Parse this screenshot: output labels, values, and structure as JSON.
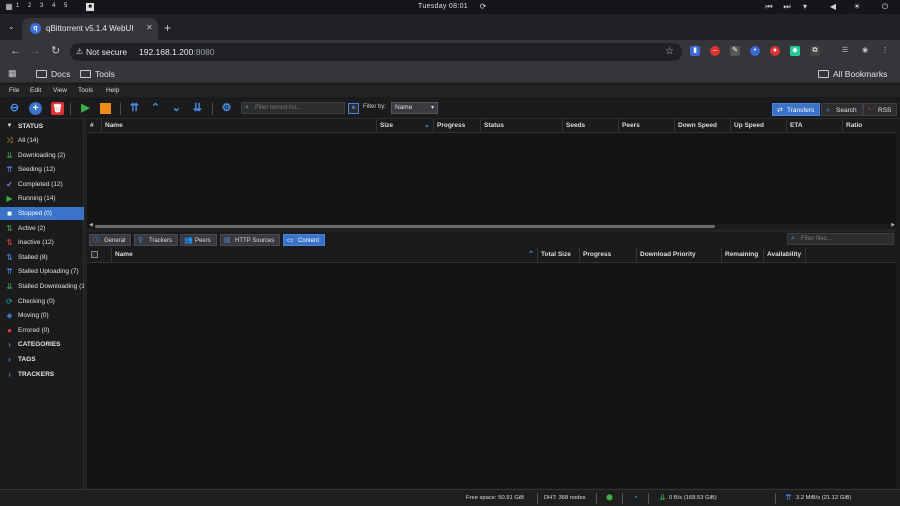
{
  "os": {
    "workspaces": [
      "1",
      "2",
      "3",
      "4",
      "5"
    ],
    "clock": "Tuesday 08:01"
  },
  "browser": {
    "tab_title": "qBittorrent v5.1.4 WebUI",
    "new_tab": "+",
    "address": {
      "security": "Not secure",
      "host": "192.168.1.200",
      "port": ":8080"
    },
    "bookmarks": [
      "Docs",
      "Tools"
    ],
    "all_bookmarks": "All Bookmarks"
  },
  "menu": [
    "File",
    "Edit",
    "View",
    "Tools",
    "Help"
  ],
  "toolbar": {
    "filter_placeholder": "Filter torrent list...",
    "filter_by_label": "Filter by:",
    "filter_by_value": "Name",
    "buttons": [
      "Transfers",
      "Search",
      "RSS"
    ]
  },
  "sidebar": {
    "status_header": "STATUS",
    "items": [
      {
        "label": "All (14)",
        "icon": "shuffle-icon",
        "color": "#f0a030"
      },
      {
        "label": "Downloading (2)",
        "icon": "download-icon",
        "color": "#3cb043"
      },
      {
        "label": "Seeding (12)",
        "icon": "upload-icon",
        "color": "#4a8fe7"
      },
      {
        "label": "Completed (12)",
        "icon": "check-icon",
        "color": "#a36ad8"
      },
      {
        "label": "Running (14)",
        "icon": "play-icon",
        "color": "#3cb043"
      },
      {
        "label": "Stopped (0)",
        "icon": "stop-icon",
        "color": "#ffffff"
      },
      {
        "label": "Active (2)",
        "icon": "updown-icon",
        "color": "#3cb043"
      },
      {
        "label": "Inactive (12)",
        "icon": "updown-icon",
        "color": "#e04040"
      },
      {
        "label": "Stalled (8)",
        "icon": "updown-icon",
        "color": "#4a8fe7"
      },
      {
        "label": "Stalled Uploading (7)",
        "icon": "upload-icon",
        "color": "#4a8fe7"
      },
      {
        "label": "Stalled Downloading (1)",
        "icon": "download-icon",
        "color": "#3cb043"
      },
      {
        "label": "Checking (0)",
        "icon": "refresh-icon",
        "color": "#20b0b0"
      },
      {
        "label": "Moving (0)",
        "icon": "move-icon",
        "color": "#4a8fe7"
      },
      {
        "label": "Errored (0)",
        "icon": "error-icon",
        "color": "#e04040"
      }
    ],
    "sections": [
      "CATEGORIES",
      "TAGS",
      "TRACKERS"
    ]
  },
  "torrent_table": {
    "columns": [
      "#",
      "Name",
      "Size",
      "Progress",
      "Status",
      "Seeds",
      "Peers",
      "Down Speed",
      "Up Speed",
      "ETA",
      "Ratio"
    ]
  },
  "properties": {
    "tabs": [
      "General",
      "Trackers",
      "Peers",
      "HTTP Sources",
      "Content"
    ],
    "filter_placeholder": "Filter files...",
    "columns": [
      "Name",
      "Total Size",
      "Progress",
      "Download Priority",
      "Remaining",
      "Availability"
    ]
  },
  "statusbar": {
    "free_space": "Free space: 50.91 GiB",
    "dht": "DHT: 368 nodes",
    "download": "0 B/s (168.53 GiB)",
    "upload": "3.2 MiB/s (21.12 GiB)"
  }
}
